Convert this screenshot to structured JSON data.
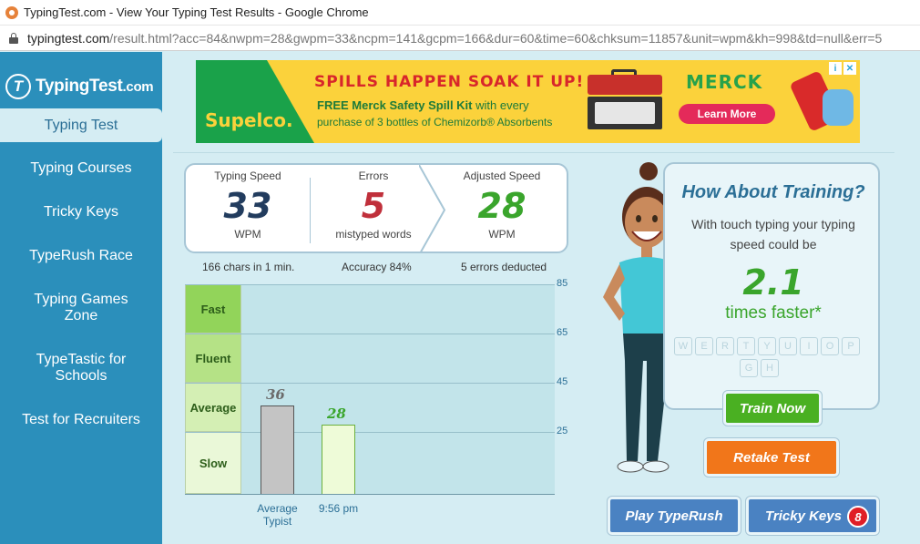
{
  "window": {
    "title": "TypingTest.com - View Your Typing Test Results - Google Chrome",
    "url_host": "typingtest.com",
    "url_rest": "/result.html?acc=84&nwpm=28&gwpm=33&ncpm=141&gcpm=166&dur=60&time=60&chksum=11857&unit=wpm&kh=998&td=null&err=5"
  },
  "logo": {
    "mark": "T",
    "name": "TypingTest",
    "suffix": ".com"
  },
  "sidebar": {
    "items": [
      {
        "label": "Typing Test",
        "active": true
      },
      {
        "label": "Typing Courses"
      },
      {
        "label": "Tricky Keys"
      },
      {
        "label": "TypeRush Race"
      },
      {
        "label": "Typing Games Zone"
      },
      {
        "label": "TypeTastic for Schools"
      },
      {
        "label": "Test for Recruiters"
      }
    ]
  },
  "ad": {
    "brand_left": "Supelco.",
    "headline": "SPILLS HAPPEN SOAK IT UP!",
    "offer_bold": "FREE Merck Safety Spill Kit",
    "offer_thin": " with every",
    "offer_line3": "purchase of 3 bottles of Chemizorb® Absorbents",
    "brand_right": "MERCK",
    "cta": "Learn More",
    "info_icon": "i",
    "close_icon": "✕"
  },
  "results": {
    "speed": {
      "label": "Typing Speed",
      "value": "33",
      "unit": "WPM"
    },
    "errors": {
      "label": "Errors",
      "value": "5",
      "unit": "mistyped words"
    },
    "adjusted": {
      "label": "Adjusted Speed",
      "value": "28",
      "unit": "WPM"
    },
    "sub": {
      "chars": "166 chars in 1 min.",
      "accuracy": "Accuracy 84%",
      "deducted": "5 errors deducted"
    }
  },
  "chart_data": {
    "type": "bar",
    "categories": [
      "Average Typist",
      "9:56 pm"
    ],
    "values": [
      36,
      28
    ],
    "data_labels": [
      "36",
      "28"
    ],
    "yticks": [
      "85",
      "65",
      "45",
      "25"
    ],
    "ylim": [
      0,
      85
    ],
    "bands": [
      {
        "label": "Fast",
        "from": 65,
        "to": 85,
        "color": "#92d45a"
      },
      {
        "label": "Fluent",
        "from": 45,
        "to": 65,
        "color": "#b5e286"
      },
      {
        "label": "Average",
        "from": 25,
        "to": 45,
        "color": "#d4efb4"
      },
      {
        "label": "Slow",
        "from": 0,
        "to": 25,
        "color": "#eaf8d8"
      }
    ],
    "bar_colors": [
      "#c4c4c4",
      "#eefbd8"
    ],
    "label_colors": [
      "#6b6b6b",
      "#3aa52c"
    ]
  },
  "training": {
    "title": "How About Training?",
    "desc": "With touch typing your typing speed could be",
    "multiplier": "2.1",
    "faster": "times faster*",
    "keys": [
      "W",
      "E",
      "R",
      "T",
      "Y",
      "U",
      "I",
      "O",
      "P",
      "G",
      "H"
    ]
  },
  "buttons": {
    "train": "Train Now",
    "retake": "Retake Test",
    "typerush": "Play TypeRush",
    "tricky": "Tricky Keys",
    "tricky_badge": "8"
  }
}
